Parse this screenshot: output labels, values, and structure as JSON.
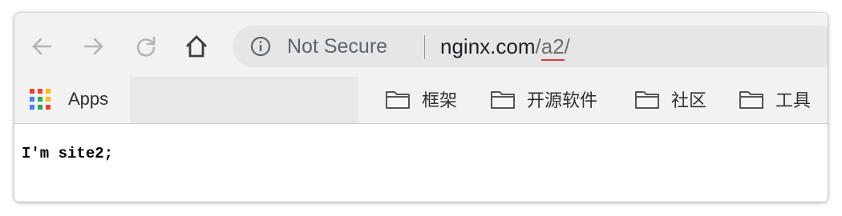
{
  "toolbar": {
    "back_icon": "arrow-left-icon",
    "forward_icon": "arrow-right-icon",
    "reload_icon": "reload-icon",
    "home_icon": "home-icon"
  },
  "omnibox": {
    "info_icon": "info-circle-icon",
    "security_text": "Not Secure",
    "url_host": "nginx.com",
    "url_path_prefix": "/",
    "url_path_highlight": "a2",
    "url_path_suffix": "/"
  },
  "bookmarks": {
    "apps_label": "Apps",
    "items": [
      {
        "label": "框架",
        "icon": "folder-icon"
      },
      {
        "label": "开源软件",
        "icon": "folder-icon"
      },
      {
        "label": "社区",
        "icon": "folder-icon"
      },
      {
        "label": "工具",
        "icon": "folder-icon"
      }
    ]
  },
  "page": {
    "text": "I'm site2;"
  },
  "colors": {
    "toolbar_bg": "#f2f2f2",
    "omnibox_bg": "#e6e6e6",
    "underline_accent": "#e53935",
    "apps_grid": [
      "#ea4335",
      "#fbbc05",
      "#34a853",
      "#4285f4"
    ]
  }
}
